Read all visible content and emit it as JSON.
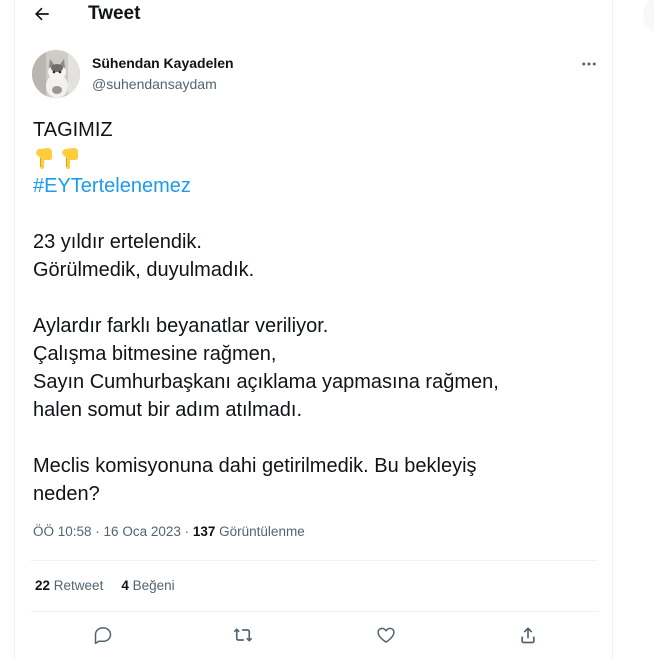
{
  "header": {
    "title": "Tweet"
  },
  "author": {
    "display_name": "Sühendan Kayadelen",
    "username": "@suhendansaydam"
  },
  "tweet": {
    "line_1": "TAGIMIZ",
    "emoji_alt": "👇👇",
    "hashtag": "#EYTertelenemez",
    "para_1_line_1": "23 yıldır ertelendik.",
    "para_1_line_2": "Görülmedik, duyulmadık.",
    "para_2_line_1": "Aylardır farklı beyanatlar veriliyor.",
    "para_2_line_2": "Çalışma bitmesine rağmen,",
    "para_2_line_3": "Sayın Cumhurbaşkanı açıklama yapmasına rağmen,",
    "para_2_line_4": "halen somut bir adım atılmadı.",
    "para_3_line_1": "Meclis komisyonuna dahi getirilmedik. Bu bekleyiş",
    "para_3_line_2": "neden?"
  },
  "meta": {
    "time": "ÖÖ 10:58",
    "date": "16 Oca 2023",
    "separator": " · ",
    "views_count": "137",
    "views_label": "Görüntülenme"
  },
  "stats": {
    "retweets_count": "22",
    "retweets_label": "Retweet",
    "likes_count": "4",
    "likes_label": "Beğeni"
  },
  "icons": {
    "back": "arrow-left-icon",
    "more": "more-horizontal-icon",
    "reply": "reply-icon",
    "retweet": "retweet-icon",
    "like": "heart-icon",
    "share": "share-icon"
  },
  "colors": {
    "accent": "#1d9bf0",
    "secondary_text": "#536471",
    "divider": "#eff3f4"
  }
}
